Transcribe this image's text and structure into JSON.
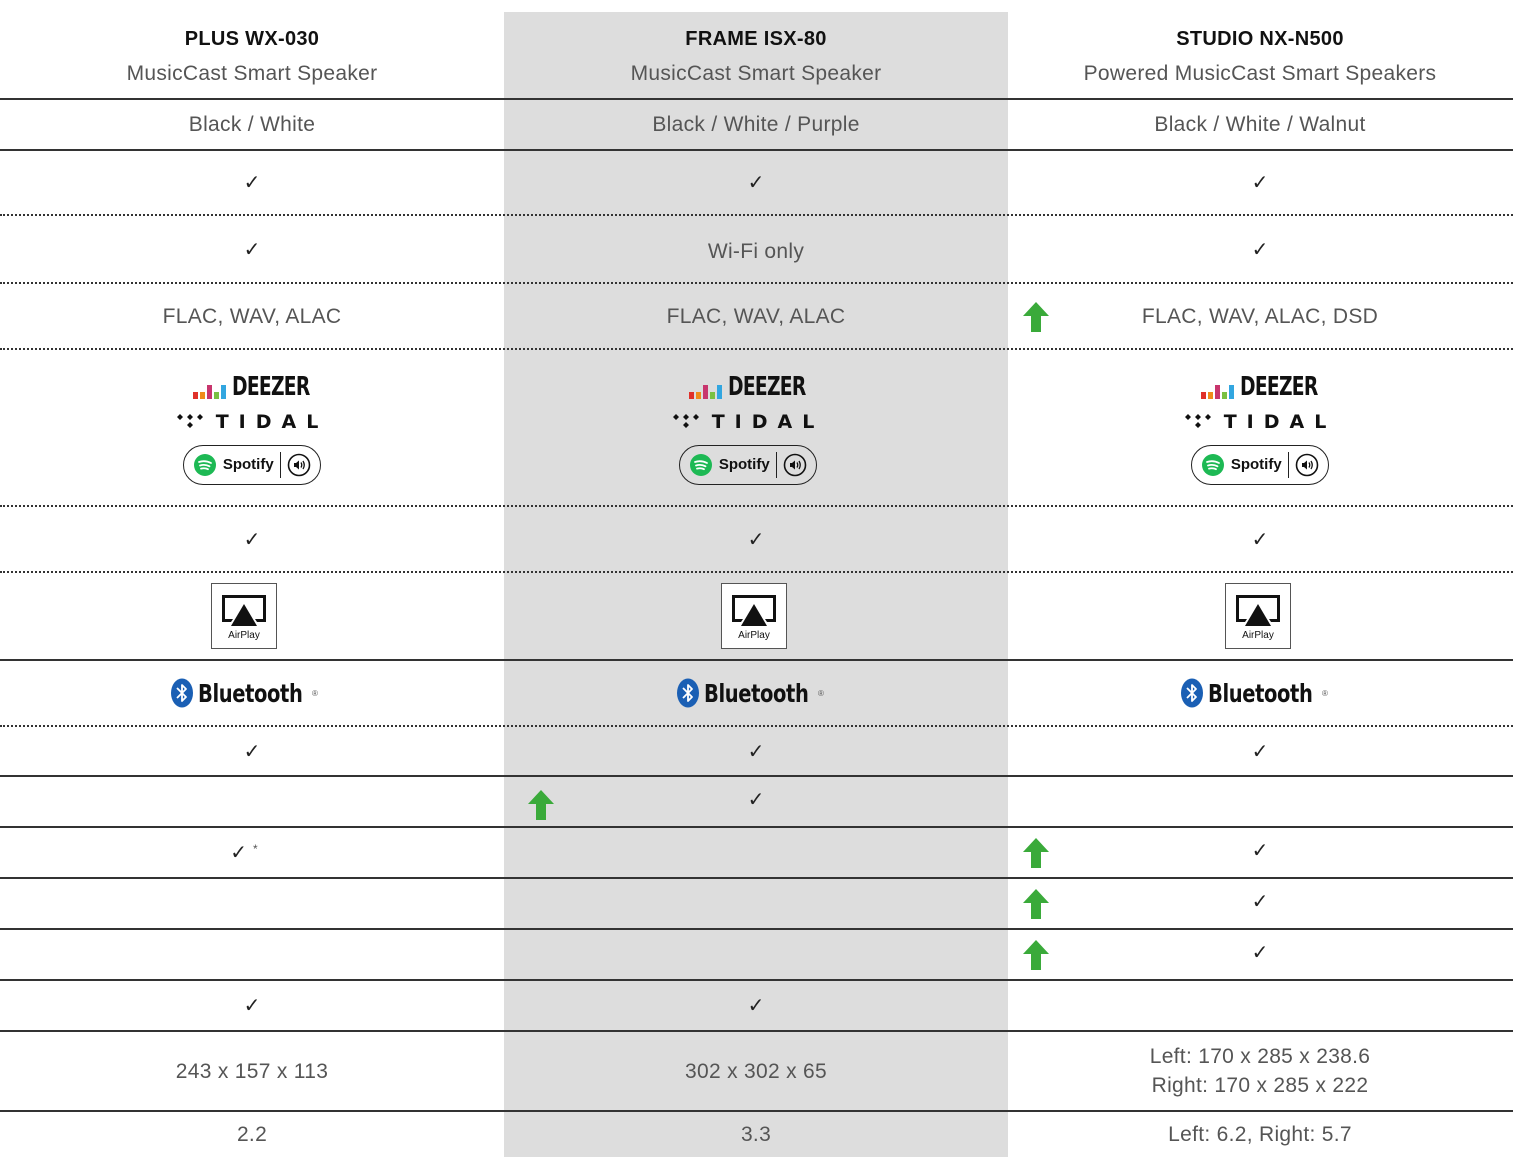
{
  "products": [
    {
      "model": "PLUS WX-030",
      "subtitle": "MusicCast Smart Speaker",
      "colors": "Black / White",
      "network_check": "✓",
      "wifi_value": "✓",
      "formats": "FLAC, WAV, ALAC",
      "streaming_check": "✓",
      "bt_row_check": "✓",
      "row11": "",
      "row12": "✓",
      "row12_note": "*",
      "row13": "",
      "row14": "",
      "row15": "✓",
      "dimensions": [
        "243 x 157 x 113"
      ],
      "weight": "2.2"
    },
    {
      "model": "FRAME ISX-80",
      "subtitle": "MusicCast Smart Speaker",
      "colors": "Black / White / Purple",
      "network_check": "✓",
      "wifi_value": "Wi-Fi only",
      "formats": "FLAC, WAV, ALAC",
      "streaming_check": "✓",
      "bt_row_check": "✓",
      "row11": "✓",
      "row12": "",
      "row12_note": "",
      "row13": "",
      "row14": "",
      "row15": "✓",
      "dimensions": [
        "302 x 302 x 65"
      ],
      "weight": "3.3"
    },
    {
      "model": "STUDIO NX-N500",
      "subtitle": "Powered MusicCast Smart Speakers",
      "colors": "Black / White / Walnut",
      "network_check": "✓",
      "wifi_value": "✓",
      "formats": "FLAC, WAV, ALAC, DSD",
      "streaming_check": "✓",
      "bt_row_check": "✓",
      "row11": "",
      "row12": "✓",
      "row12_note": "",
      "row13": "✓",
      "row14": "✓",
      "row15": "",
      "dimensions": [
        "Left: 170 x 285 x 238.6",
        "Right: 170 x 285 x 222"
      ],
      "weight": "Left: 6.2, Right: 5.7"
    }
  ],
  "logos": {
    "deezer": "DEEZER",
    "tidal": "TIDAL",
    "spotify": "Spotify",
    "airplay": "AirPlay",
    "bluetooth": "Bluetooth",
    "registered": "®"
  },
  "colors": {
    "shade": "#dddddd",
    "arrow": "#3aaa3a",
    "spotify": "#1db954",
    "bluetooth": "#1a5fb4"
  },
  "icons": {
    "upgrade": "green-up-arrow-icon",
    "check": "checkmark-icon"
  }
}
